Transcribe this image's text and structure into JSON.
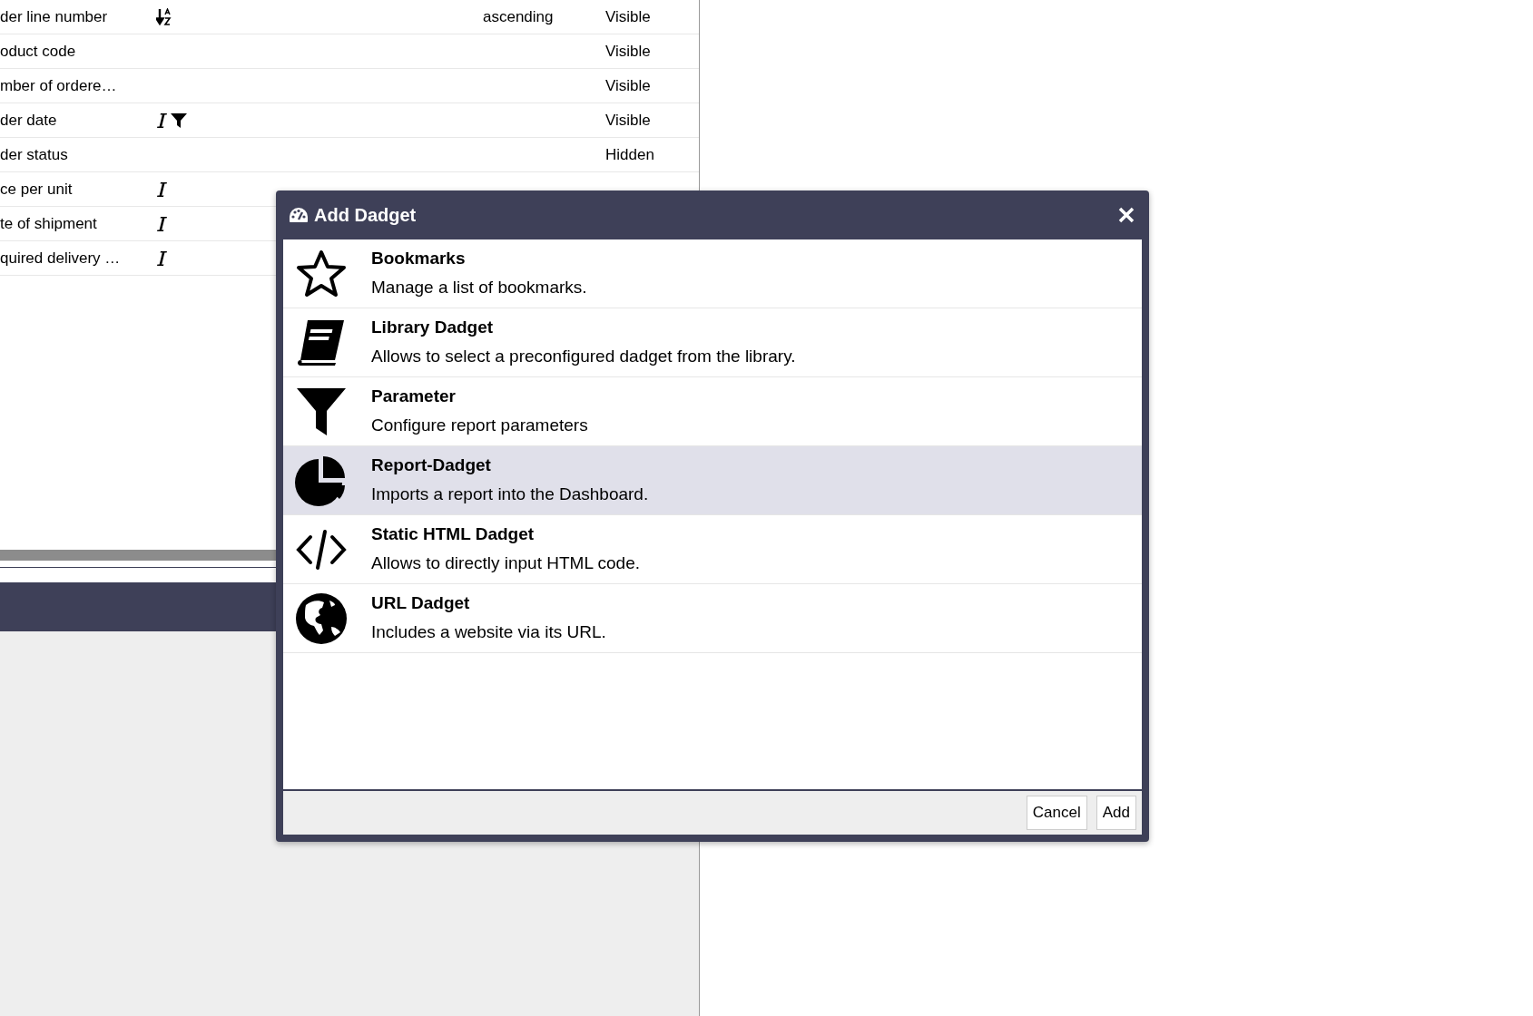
{
  "columns_table": {
    "rows": [
      {
        "name": "der line number",
        "sorted": true,
        "italic": false,
        "filtered": false,
        "sort": "ascending",
        "visibility": "Visible"
      },
      {
        "name": "oduct code",
        "sorted": false,
        "italic": false,
        "filtered": false,
        "visibility": "Visible"
      },
      {
        "name": "mber of ordere…",
        "sorted": false,
        "italic": false,
        "filtered": false,
        "visibility": "Visible"
      },
      {
        "name": "der date",
        "sorted": false,
        "italic": true,
        "filtered": true,
        "visibility": "Visible"
      },
      {
        "name": "der status",
        "sorted": false,
        "italic": false,
        "filtered": false,
        "visibility": "Hidden"
      },
      {
        "name": "ce per unit",
        "sorted": false,
        "italic": true,
        "filtered": false
      },
      {
        "name": "te of shipment",
        "sorted": false,
        "italic": true,
        "filtered": false
      },
      {
        "name": "quired delivery …",
        "sorted": false,
        "italic": true,
        "filtered": false
      }
    ]
  },
  "dialog": {
    "title": "Add Dadget",
    "items": [
      {
        "kind": "star",
        "title": "Bookmarks",
        "description": "Manage a list of bookmarks.",
        "selected": false
      },
      {
        "kind": "book",
        "title": "Library Dadget",
        "description": "Allows to select a preconfigured dadget from the library.",
        "selected": false
      },
      {
        "kind": "filter",
        "title": "Parameter",
        "description": "Configure report parameters",
        "selected": false
      },
      {
        "kind": "pie",
        "title": "Report-Dadget",
        "description": "Imports a report into the Dashboard.",
        "selected": true
      },
      {
        "kind": "code",
        "title": "Static HTML Dadget",
        "description": "Allows to directly input HTML code.",
        "selected": false
      },
      {
        "kind": "globe",
        "title": "URL Dadget",
        "description": "Includes a website via its URL.",
        "selected": false
      }
    ],
    "buttons": [
      "Cancel",
      "Add"
    ]
  }
}
